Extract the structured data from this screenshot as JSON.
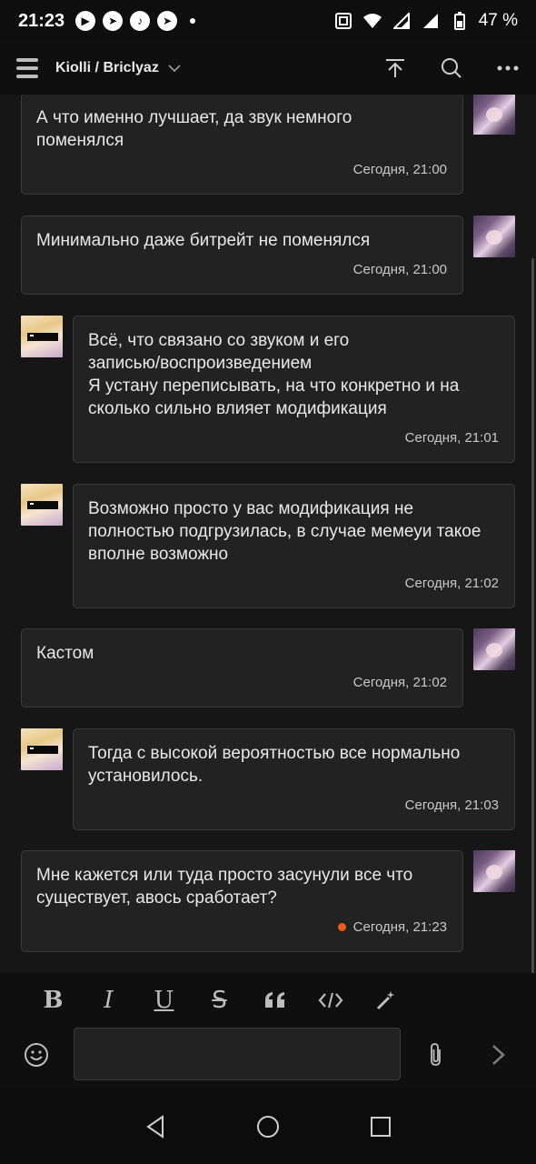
{
  "status_bar": {
    "time": "21:23",
    "battery": "47 %"
  },
  "header": {
    "title": "Kiolli / Briclyaz"
  },
  "messages": [
    {
      "side": "right",
      "avatar": "anime-avatar",
      "text": "А что именно лучшает, да звук немного\nпоменялся",
      "time": "Сегодня, 21:00",
      "unread": false
    },
    {
      "side": "right",
      "avatar": "anime-avatar",
      "text": "Минимально даже битрейт не поменялся",
      "time": "Сегодня, 21:00",
      "unread": false
    },
    {
      "side": "left",
      "avatar": "sunglasses-avatar",
      "text": "Всё, что связано со звуком и его\nзаписью/воспроизведением\nЯ устану переписывать, на что конкретно и на\nсколько сильно влияет модификация",
      "time": "Сегодня, 21:01",
      "unread": false
    },
    {
      "side": "left",
      "avatar": "sunglasses-avatar",
      "text": "Возможно просто у вас модификация не\nполностью подгрузилась, в случае мемеуи такое\nвполне возможно",
      "time": "Сегодня, 21:02",
      "unread": false
    },
    {
      "side": "right",
      "avatar": "anime-avatar",
      "text": "Кастом",
      "time": "Сегодня, 21:02",
      "unread": false
    },
    {
      "side": "left",
      "avatar": "sunglasses-avatar",
      "text": "Тогда с высокой вероятностью все нормально\nустановилось.",
      "time": "Сегодня, 21:03",
      "unread": false
    },
    {
      "side": "right",
      "avatar": "anime-avatar",
      "text": "Мне кажется или туда просто засунули все что\nсуществует, авось сработает?",
      "time": "Сегодня, 21:23",
      "unread": true
    }
  ],
  "format_toolbar": {
    "bold": "B",
    "italic": "I",
    "underline": "U",
    "strike": "S"
  },
  "composer": {
    "value": "",
    "placeholder": ""
  },
  "colors": {
    "unread_dot": "#e2601c",
    "bubble_bg": "#222222",
    "page_bg": "#161616"
  }
}
